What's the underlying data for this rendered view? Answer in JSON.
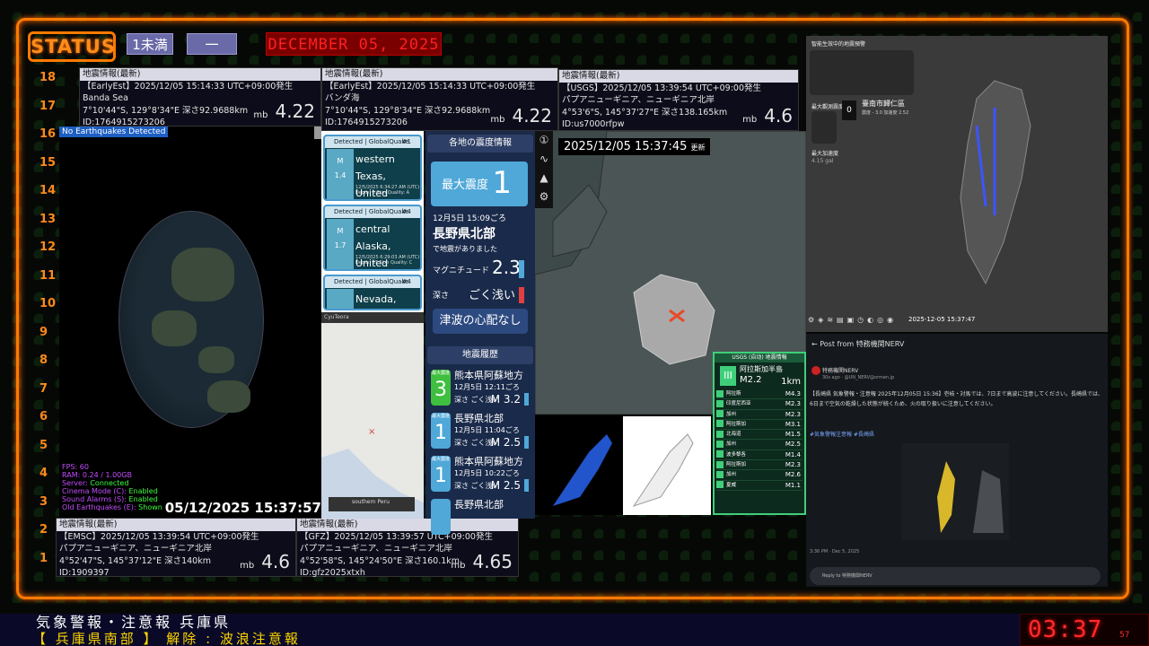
{
  "header": {
    "status": "STATUS",
    "pill1": "1未満",
    "pill2": "一",
    "date_banner": "DECEMBER 05, 2025"
  },
  "scale": [
    "18",
    "17",
    "16",
    "15",
    "14",
    "13",
    "12",
    "11",
    "10",
    "9",
    "8",
    "7",
    "6",
    "5",
    "4",
    "3",
    "2",
    "1"
  ],
  "quakes": {
    "a": {
      "hdr": "地震情報(最新)",
      "l1": "【EarlyEst】2025/12/05  15:14:33  UTC+09:00発生",
      "l2": "Banda Sea",
      "l3": "7°10'44\"S,  129°8'34\"E   深さ92.9688km",
      "l4": "ID:1764915273206",
      "unit": "mb",
      "mag": "4.22"
    },
    "b": {
      "hdr": "地震情報(最新)",
      "l1": "【EarlyEst】2025/12/05  15:14:33  UTC+09:00発生",
      "l2": "バンダ海",
      "l3": "7°10'44\"S,  129°8'34\"E   深さ92.9688km",
      "l4": "ID:1764915273206",
      "unit": "mb",
      "mag": "4.22"
    },
    "c": {
      "hdr": "地震情報(最新)",
      "l1": "【USGS】2025/12/05  13:39:54  UTC+09:00発生",
      "l2": "パプアニューギニア、ニューギニア北岸",
      "l3": "4°53'6\"S,  145°37'27\"E   深さ138.165km",
      "l4": "ID:us7000rfpw",
      "unit": "mb",
      "mag": "4.6"
    },
    "d": {
      "hdr": "地震情報(最新)",
      "l1": "【EMSC】2025/12/05  13:39:54  UTC+09:00発生",
      "l2": "パプアニューギニア、ニューギニア北岸",
      "l3": "4°52'47\"S,  145°37'12\"E   深さ140km",
      "l4": "ID:1909397",
      "unit": "mb",
      "mag": "4.6"
    },
    "e": {
      "hdr": "地震情報(最新)",
      "l1": "【GFZ】2025/12/05  13:39:57  UTC+09:00発生",
      "l2": "パプアニューギニア、ニューギニア北岸",
      "l3": "4°52'58\"S,  145°24'50\"E   深さ160.1km",
      "l4": "ID:gfz2025xtxh",
      "unit": "mb",
      "mag": "4.65"
    }
  },
  "globe": {
    "no_eq": "No Earthquakes Detected",
    "fps": "FPS: 60",
    "ram": "RAM: 0.24 / 1.00GB",
    "server": "Server: ",
    "server_v": "Connected",
    "cinema": "Cinema Mode (C): ",
    "cinema_v": "Enabled",
    "sound": "Sound Alarms (S): ",
    "sound_v": "Enabled",
    "old": "Old Earthquakes (E): ",
    "old_v": "Shown",
    "time": "05/12/2025 15:37:57"
  },
  "globalquake": [
    {
      "hdr": "Detected | GlobalQuake",
      "num": "#1",
      "m": "M",
      "mag": "1.4",
      "place1": "western Texas,",
      "place2": "United States",
      "d1": "12/5/2025 6:34:27 AM (UTC)",
      "d2": "Depth: 0.0km     Quality: A"
    },
    {
      "hdr": "Detected | GlobalQuake",
      "num": "#4",
      "m": "M",
      "mag": "1.7",
      "place1": "central Alaska,",
      "place2": "United States",
      "d1": "12/5/2025 6:29:03 AM (UTC)",
      "d2": "Depth: 87.5km   Quality: C"
    },
    {
      "hdr": "Detected | GlobalQuake",
      "num": "#4",
      "m": "",
      "mag": "",
      "place1": "Nevada, United",
      "place2": "",
      "d1": "",
      "d2": ""
    }
  ],
  "gq_map": {
    "bar": "CyuTeora",
    "label": "southern Peru"
  },
  "nerv": {
    "title": "各地の震度情報",
    "max_label": "最大震度",
    "max_val": "1",
    "date": "12月5日 15:09ごろ",
    "region": "長野県北部",
    "note": "で地震がありました",
    "mag_label": "マグニチュード",
    "mag_val": "2.3",
    "depth_label": "深さ",
    "depth_val": "ごく浅い",
    "tsunami": "津波の心配なし",
    "hist_title": "地震履歴",
    "history": [
      {
        "badge": "3",
        "cap": "最大震度",
        "region": "熊本県阿蘇地方",
        "time": "12月5日 12:11ごろ",
        "depth": "深さ ごく浅い",
        "mag": "M 3.2",
        "color": "#3fbf3f"
      },
      {
        "badge": "1",
        "cap": "最大震度",
        "region": "長野県北部",
        "time": "12月5日 11:04ごろ",
        "depth": "深さ ごく浅い",
        "mag": "M 2.5",
        "color": "#4fa8d8"
      },
      {
        "badge": "1",
        "cap": "最大震度",
        "region": "熊本県阿蘇地方",
        "time": "12月5日 10:22ごろ",
        "depth": "深さ ごく浅い",
        "mag": "M 2.5",
        "color": "#4fa8d8"
      },
      {
        "badge": "",
        "cap": "",
        "region": "長野県北部",
        "time": "",
        "depth": "",
        "mag": "",
        "color": "#4fa8d8"
      }
    ]
  },
  "toolbar": [
    "①",
    "∿",
    "▲",
    "⚙"
  ],
  "jmap": {
    "time": "2025/12/05  15:37:45",
    "suffix": "更新"
  },
  "usgs": {
    "hdr": "USGS (自动) 地震情報",
    "lvl": "III",
    "name": "阿拉斯加半島",
    "mag": "M2.2",
    "depth": "1km",
    "list": [
      {
        "n": "阿拉斯",
        "m": "M4.3"
      },
      {
        "n": "印度尼西亚",
        "m": "M2.3"
      },
      {
        "n": "加州",
        "m": "M2.3"
      },
      {
        "n": "阿拉斯加",
        "m": "M3.1"
      },
      {
        "n": "北海道",
        "m": "M1.5"
      },
      {
        "n": "加州",
        "m": "M2.5"
      },
      {
        "n": "波多黎各",
        "m": "M1.4"
      },
      {
        "n": "阿拉斯加",
        "m": "M2.3"
      },
      {
        "n": "加州",
        "m": "M2.6"
      },
      {
        "n": "夏威",
        "m": "M1.1"
      }
    ]
  },
  "tw": {
    "title": "智能生效中的地震預警",
    "place": "臺南市歸仁區",
    "zero": "0",
    "sub": "震度 - 3.0    加速度 2.52",
    "left1": "最大觀測震度",
    "left2": "最大加速度",
    "left3": "4.15 gal",
    "time": "2025-12-05 15:37:47",
    "icons": "⚙◈≋▤▣◷◐◎◉"
  },
  "post": {
    "header": "←  Post from 特務機関NERV",
    "name": "特務機関NERV",
    "user": "30s ago · @UN_NERV@ormen.jp",
    "text": "【長崎県 気象警報・注意報 2025年12月05日 15:36】壱岐・対馬では、7日まで高波に注意してください。長崎県では、6日まで空気の乾燥した状態が続くため、火の取り扱いに注意してください。",
    "tags": "#気象警報注意報 #長崎県",
    "date": "3:36 PM · Dec 5, 2025",
    "reply": "Reply to 特務機関NERV"
  },
  "ticker": {
    "line1": "気象警報・注意報 兵庫県",
    "line2": "【 兵庫県南部 】  解除 : 波浪注意報"
  },
  "clock": {
    "time": "03:37",
    "sec": "57"
  }
}
